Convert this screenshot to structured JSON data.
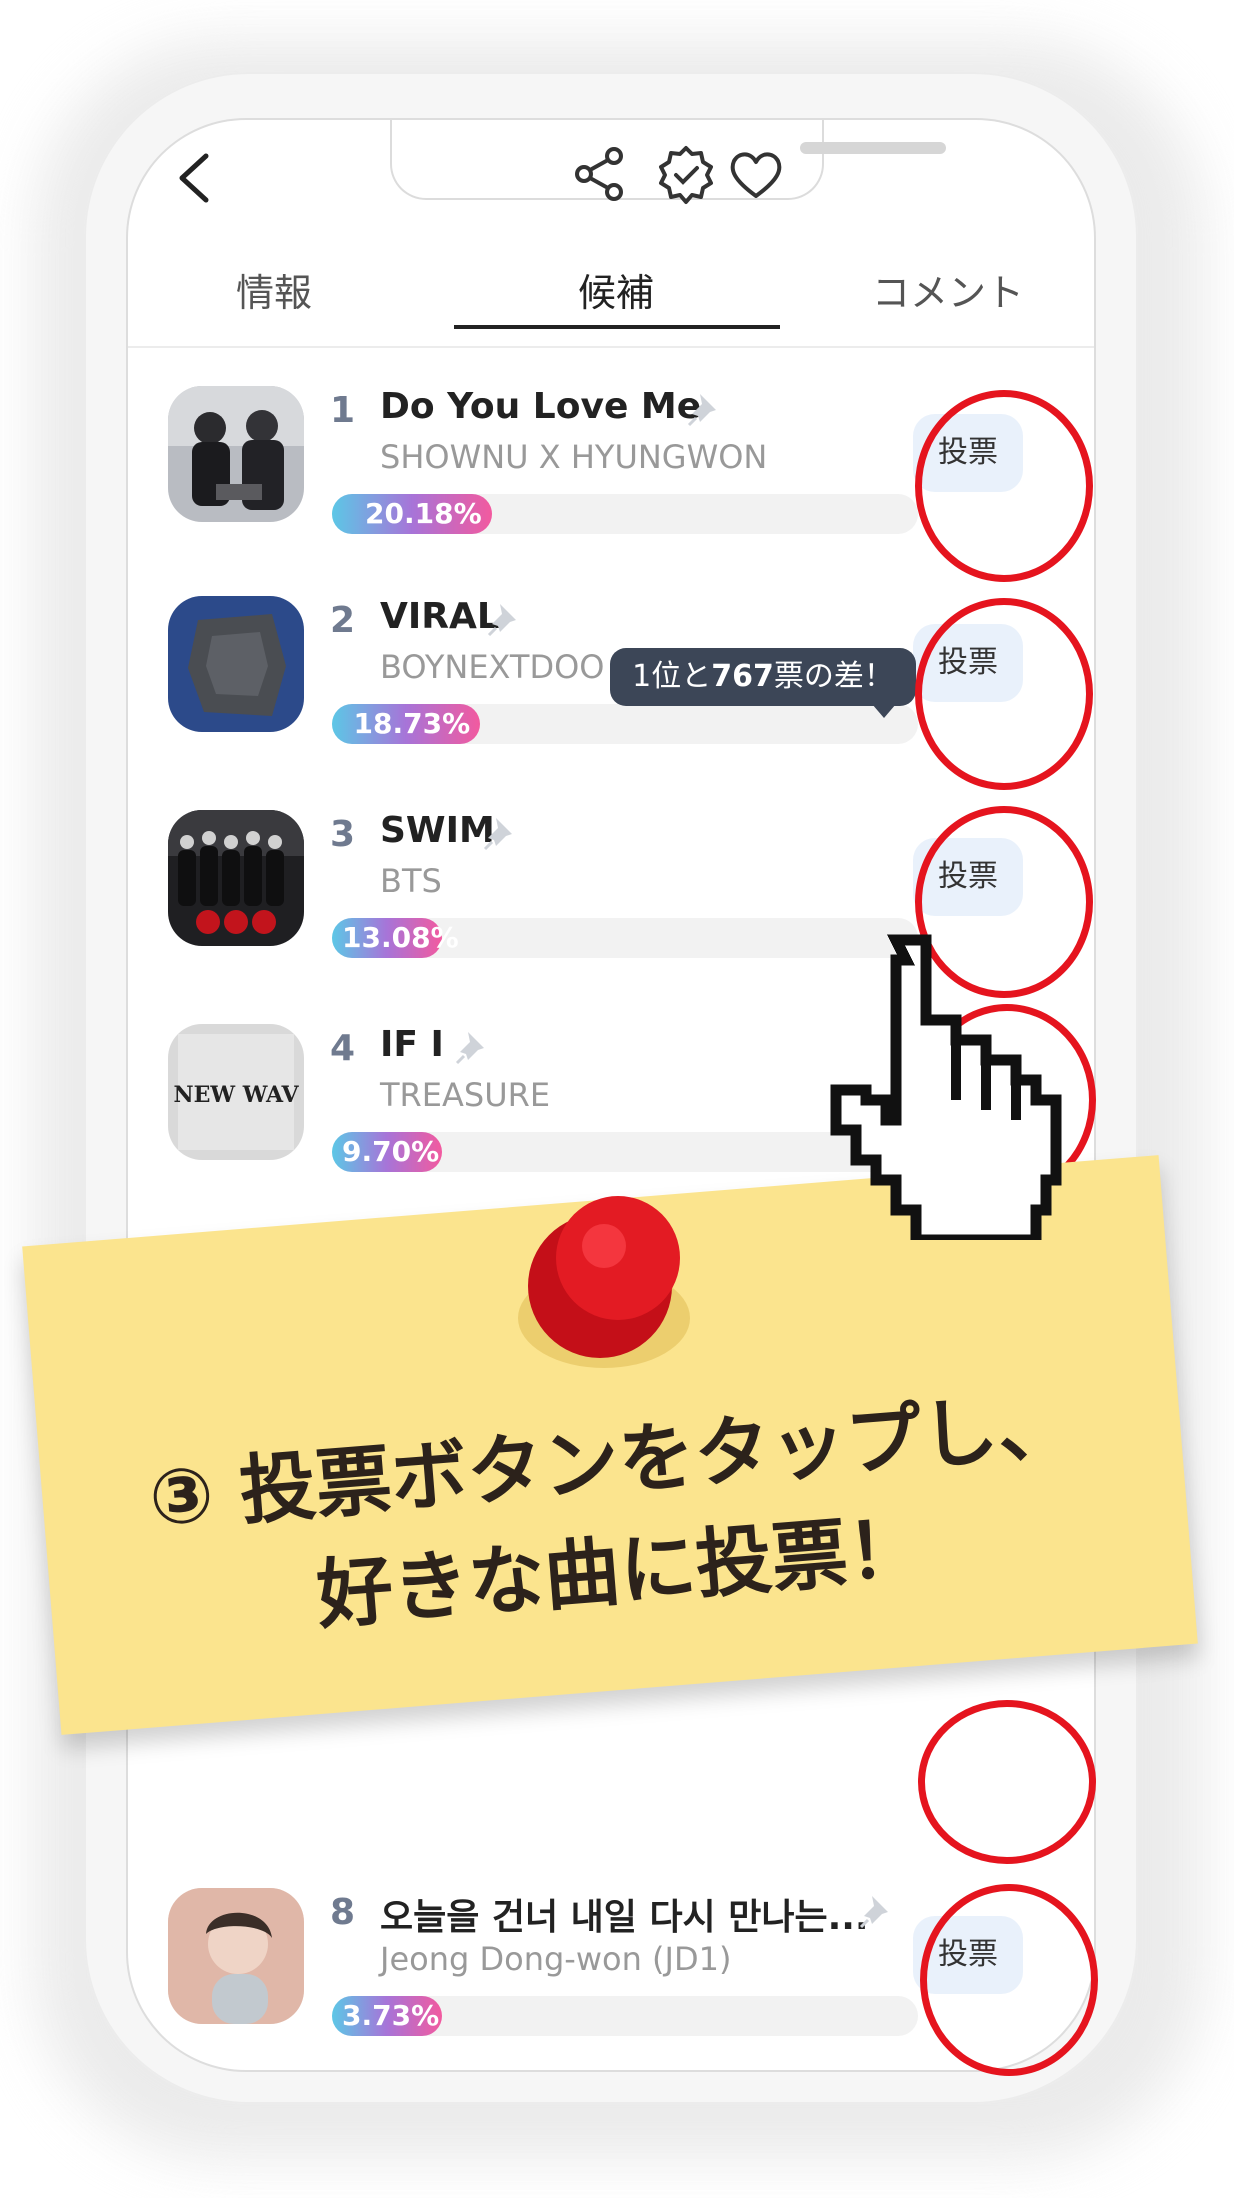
{
  "header": {
    "back_icon": "chevron-left-icon",
    "share_icon": "share-icon",
    "badge_icon": "verified-badge-icon",
    "heart_icon": "heart-icon"
  },
  "tabs": [
    {
      "label": "情報"
    },
    {
      "label": "候補",
      "active": true
    },
    {
      "label": "コメント"
    }
  ],
  "candidates": [
    {
      "rank": "1",
      "title": "Do You Love Me",
      "artist": "SHOWNU X HYUNGWON",
      "percent": "20.18%",
      "fraction": 0.2018,
      "vote": "投票"
    },
    {
      "rank": "2",
      "title": "VIRAL",
      "artist": "BOYNEXTDOO",
      "percent": "18.73%",
      "fraction": 0.1873,
      "vote": "投票"
    },
    {
      "rank": "3",
      "title": "SWIM",
      "artist": "BTS",
      "percent": "13.08%",
      "fraction": 0.1308,
      "vote": "投票"
    },
    {
      "rank": "4",
      "title": "IF I",
      "artist": "TREASURE",
      "percent": "9.70%",
      "fraction": 0.097
    },
    {
      "rank": "8",
      "title": "오늘을 건너 내일 다시 만나는...",
      "artist": "Jeong Dong-won (JD1)",
      "percent": "3.73%",
      "fraction": 0.0373,
      "vote": "投票"
    }
  ],
  "tooltip": {
    "pre": "1位と",
    "num": "767",
    "post": "票の差！"
  },
  "album_art": {
    "4": "NEW WAV"
  },
  "note": {
    "line1": "③ 投票ボタンをタップし、",
    "line2": "好きな曲に投票！"
  },
  "colors": {
    "ring": "#e5141e",
    "note": "#fbe48e",
    "bar_start": "#5cc7e6",
    "bar_end": "#f25a9f"
  }
}
